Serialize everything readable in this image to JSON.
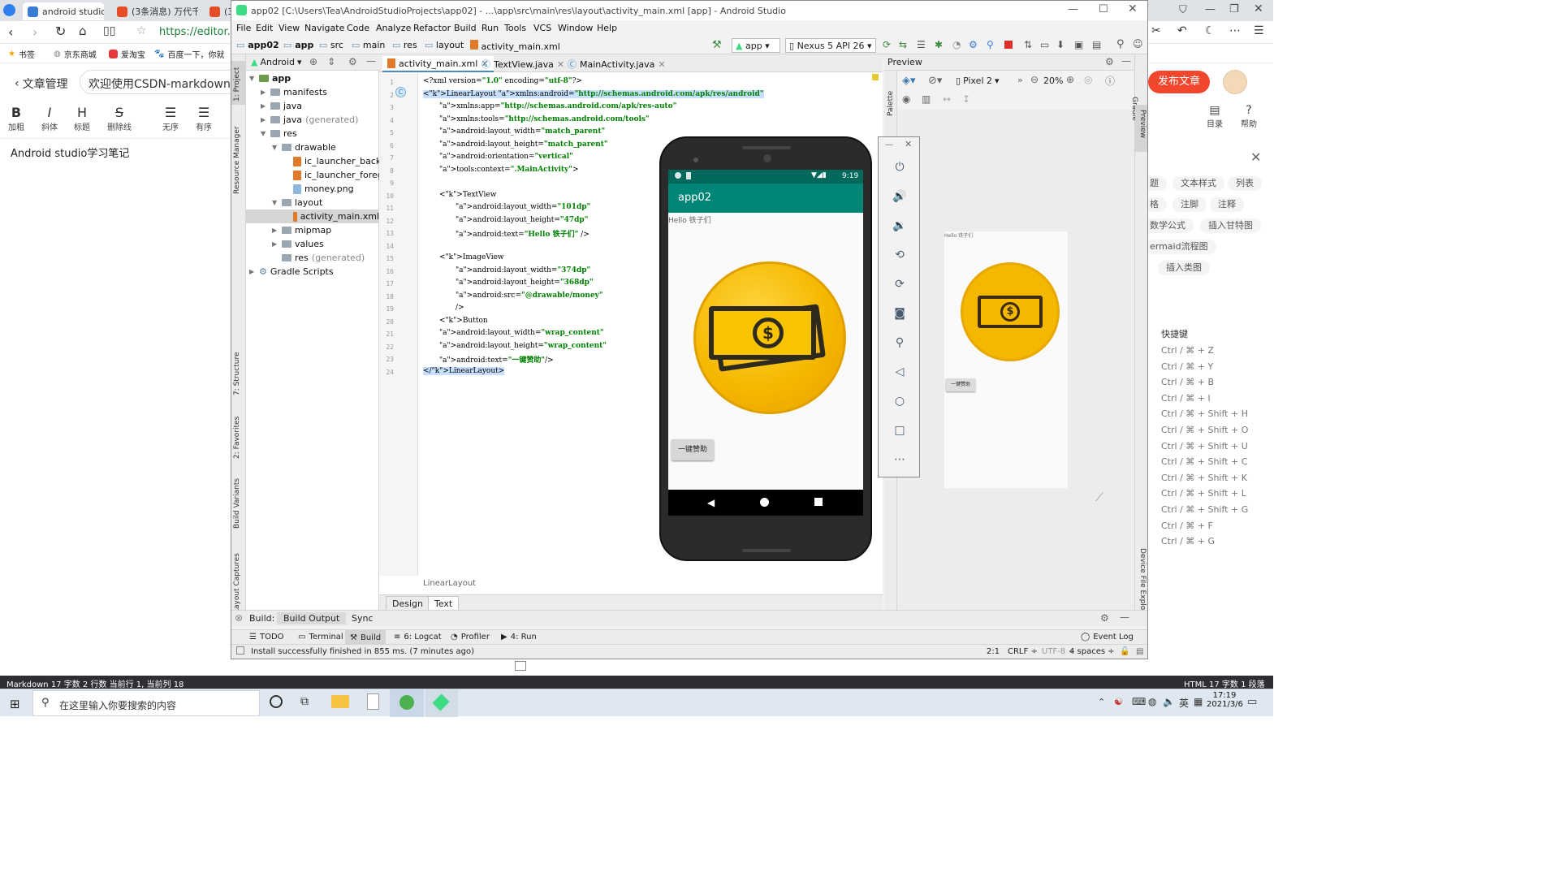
{
  "browser": {
    "tabs": [
      {
        "title": "android studio"
      },
      {
        "title": "(3条消息) 万代千"
      },
      {
        "title": "(3"
      }
    ],
    "url": "https://editor.cs",
    "bookmarks": [
      "书签",
      "京东商城",
      "爱淘宝",
      "百度一下，你就"
    ],
    "csdn": {
      "back_label": "文章管理",
      "title_input": "欢迎使用CSDN-markdown",
      "publish_button": "发布文章",
      "toolbar": [
        {
          "glyph": "B",
          "label": "加粗"
        },
        {
          "glyph": "I",
          "label": "斜体"
        },
        {
          "glyph": "H",
          "label": "标题"
        },
        {
          "glyph": "S",
          "label": "删除线"
        },
        {
          "glyph": "☰",
          "label": "无序"
        },
        {
          "glyph": "☰",
          "label": "有序"
        }
      ],
      "right_tools": [
        {
          "label": "目录"
        },
        {
          "label": "帮助"
        }
      ],
      "editor_text": "Android studio学习笔记",
      "chips_row1": [
        "题",
        "文本样式",
        "列表"
      ],
      "chips_row2": [
        "格",
        "注脚",
        "注释"
      ],
      "chips_row3": [
        "数学公式",
        "插入甘特图"
      ],
      "chips_row4": [
        "ermaid流程图"
      ],
      "chips_row5": [
        "插入类图"
      ],
      "shortcuts_title": "快捷键",
      "shortcuts": [
        "Ctrl / ⌘ + Z",
        "Ctrl / ⌘ + Y",
        "Ctrl / ⌘ + B",
        "Ctrl / ⌘ + I",
        "Ctrl / ⌘ + Shift + H",
        "Ctrl / ⌘ + Shift + O",
        "Ctrl / ⌘ + Shift + U",
        "Ctrl / ⌘ + Shift + C",
        "Ctrl / ⌘ + Shift + K",
        "Ctrl / ⌘ + Shift + L",
        "Ctrl / ⌘ + Shift + G",
        "Ctrl / ⌘ + F",
        "Ctrl / ⌘ + G"
      ],
      "status_left": "Markdown  17 字数  2 行数  当前行 1, 当前列 18",
      "status_right": "HTML  17 字数  1 段落"
    }
  },
  "studio": {
    "title": "app02 [C:\\Users\\Tea\\AndroidStudioProjects\\app02] - ...\\app\\src\\main\\res\\layout\\activity_main.xml [app] - Android Studio",
    "menu": [
      "File",
      "Edit",
      "View",
      "Navigate",
      "Code",
      "Analyze",
      "Refactor",
      "Build",
      "Run",
      "Tools",
      "VCS",
      "Window",
      "Help"
    ],
    "breadcrumbs": [
      "app02",
      "app",
      "src",
      "main",
      "res",
      "layout",
      "activity_main.xml"
    ],
    "run_config": "app",
    "device": "Nexus 5 API 26",
    "project_view": "Android",
    "tree": [
      {
        "label": "app"
      },
      {
        "label": "manifests"
      },
      {
        "label": "java"
      },
      {
        "label": "java",
        "suffix": "(generated)"
      },
      {
        "label": "res"
      },
      {
        "label": "drawable"
      },
      {
        "label": "ic_launcher_backgr"
      },
      {
        "label": "ic_launcher_foregro"
      },
      {
        "label": "money.png"
      },
      {
        "label": "layout"
      },
      {
        "label": "activity_main.xml"
      },
      {
        "label": "mipmap"
      },
      {
        "label": "values"
      },
      {
        "label": "res",
        "suffix": "(generated)"
      },
      {
        "label": "Gradle Scripts"
      }
    ],
    "editor_tabs": [
      {
        "label": "activity_main.xml"
      },
      {
        "label": "TextView.java"
      },
      {
        "label": "MainActivity.java"
      }
    ],
    "code_lines": [
      "<?xml version=\"1.0\" encoding=\"utf-8\"?>",
      "<LinearLayout xmlns:android=\"http://schemas.android.com/apk/res/android\"",
      "xmlns:app=\"http://schemas.android.com/apk/res-auto\"",
      "xmlns:tools=\"http://schemas.android.com/tools\"",
      "android:layout_width=\"match_parent\"",
      "android:layout_height=\"match_parent\"",
      "android:orientation=\"vertical\"",
      "tools:context=\".MainActivity\">",
      "",
      "<TextView",
      "android:layout_width=\"101dp\"",
      "android:layout_height=\"47dp\"",
      "android:text=\"Hello 铁子们\" />",
      "",
      "<ImageView",
      "android:layout_width=\"374dp\"",
      "android:layout_height=\"368dp\"",
      "android:src=\"@drawable/money\"",
      "/>",
      "<Button",
      "android:layout_width=\"wrap_content\"",
      "android:layout_height=\"wrap_content\"",
      "android:text=\"一键赞助\"/>",
      "</LinearLayout>"
    ],
    "line_numbers": [
      "1",
      "2",
      "3",
      "4",
      "5",
      "6",
      "7",
      "8",
      "9",
      "10",
      "11",
      "12",
      "13",
      "14",
      "15",
      "16",
      "17",
      "18",
      "19",
      "20",
      "21",
      "22",
      "23",
      "24"
    ],
    "editor_footer": "LinearLayout",
    "design_tabs": [
      "Design",
      "Text"
    ],
    "preview": {
      "title": "Preview",
      "device": "Pixel 2",
      "zoom": "20%",
      "hello": "Hello 铁子们",
      "button": "一键赞助"
    },
    "side_labels": {
      "left": [
        "1: Project",
        "Resource Manager",
        "7: Structure",
        "2: Favorites",
        "Build Variants",
        "Layout Captures"
      ],
      "right": [
        "Gradle",
        "Preview",
        "Device File Explorer"
      ],
      "palette": "Palette"
    },
    "build_tabs": [
      "Build:",
      "Build Output",
      "Sync"
    ],
    "bottom_tools": [
      "TODO",
      "Terminal",
      "Build",
      "6: Logcat",
      "Profiler",
      "4: Run",
      "Event Log"
    ],
    "status_msg": "Install successfully finished in 855 ms. (7 minutes ago)",
    "status_right": [
      "2:1",
      "CRLF",
      "UTF-8",
      "4 spaces"
    ]
  },
  "emulator": {
    "time": "9:19",
    "app_title": "app02",
    "text_view": "Hello 铁子们",
    "button": "一键赞助"
  },
  "taskbar": {
    "search_placeholder": "在这里输入你要搜索的内容",
    "ime": "英",
    "time": "17:19",
    "date": "2021/3/6"
  },
  "colors": {
    "accent_teal": "#008577",
    "publish_red": "#f2472d",
    "coin_gold": "#f5b800"
  }
}
